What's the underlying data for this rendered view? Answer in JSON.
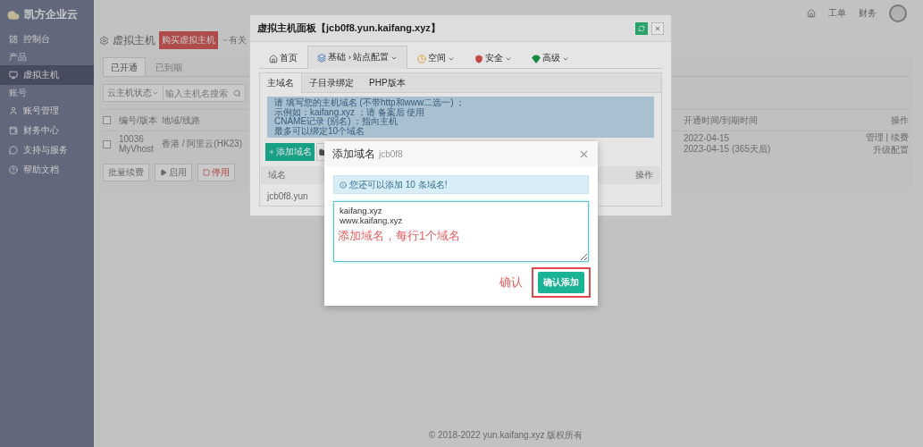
{
  "sidebar": {
    "brand": "凯方企业云",
    "items": [
      {
        "kind": "link",
        "label": "控制台",
        "selected": false
      },
      {
        "kind": "heading",
        "label": "产品"
      },
      {
        "kind": "link",
        "label": "虚拟主机",
        "selected": true
      },
      {
        "kind": "heading",
        "label": "账号"
      },
      {
        "kind": "link",
        "label": "账号管理",
        "selected": false
      },
      {
        "kind": "link",
        "label": "财务中心",
        "selected": false
      },
      {
        "kind": "link",
        "label": "支持与服务",
        "selected": false
      },
      {
        "kind": "link",
        "label": "帮助文档",
        "selected": false
      }
    ]
  },
  "topbar": {
    "links": [
      "工单",
      "财务"
    ]
  },
  "page": {
    "title": "虚拟主机",
    "buy_button": "购买虚拟主机",
    "help_link": "有关",
    "tabs": [
      {
        "label": "已开通",
        "selected": true
      },
      {
        "label": "已到期",
        "selected": false
      }
    ],
    "filter": "云主机状态",
    "search_placeholder": "输入主机名搜索",
    "columns": [
      "编号/版本",
      "地域/线路",
      "开通时间/到期时间",
      "操作"
    ],
    "header_checked": false,
    "rows": [
      {
        "checked": false,
        "id": "10036",
        "version": "MyVhost",
        "region": "香港 / 阿里云(HK23)",
        "opened": "2022-04-15",
        "expires": "2023-04-15 (365天后)",
        "actions": [
          "管理 | 续费",
          "升级配置"
        ]
      }
    ],
    "bulk_actions": [
      {
        "kind": "plain",
        "label": "批量续费"
      },
      {
        "kind": "start",
        "label": "启用"
      },
      {
        "kind": "stop",
        "label": "停用"
      }
    ]
  },
  "footer": "© 2018-2022 yun.kaifang.xyz 版权所有",
  "panel": {
    "title": "虚拟主机面板【jcb0f8.yun.kaifang.xyz】",
    "nav": [
      {
        "kind": "home",
        "label": "首页",
        "selected": false
      },
      {
        "kind": "basic",
        "label": "基础 › 站点配置",
        "selected": true
      },
      {
        "kind": "space",
        "label": "空间",
        "selected": false
      },
      {
        "kind": "security",
        "label": "安全",
        "selected": false
      },
      {
        "kind": "advanced",
        "label": "高级",
        "selected": false
      }
    ],
    "subtabs": [
      {
        "label": "主域名",
        "selected": true
      },
      {
        "label": "子目录绑定",
        "selected": false
      },
      {
        "label": "PHP版本",
        "selected": false
      }
    ],
    "notes": [
      "请 填写您的主机域名 (不带http和www二选一) ；",
      "示例如：kaifang.xyz ；请 备案后 使用",
      "CNAME记录 (别名) ：指向主机",
      "最多可以绑定10个域名"
    ],
    "add_button": "添加域名",
    "columns": [
      "域名",
      "操作"
    ],
    "rows": [
      {
        "domain": "jcb0f8.yun"
      }
    ]
  },
  "dialog": {
    "title": "添加域名",
    "subtitle": "jcb0f8",
    "alert": "您还可以添加 10 条域名!",
    "value": "kaifang.xyz\nwww.kaifang.xyz",
    "confirm_button": "确认添加"
  },
  "annotations": {
    "hint": "添加域名，每行1个域名",
    "confirm": "确认"
  }
}
